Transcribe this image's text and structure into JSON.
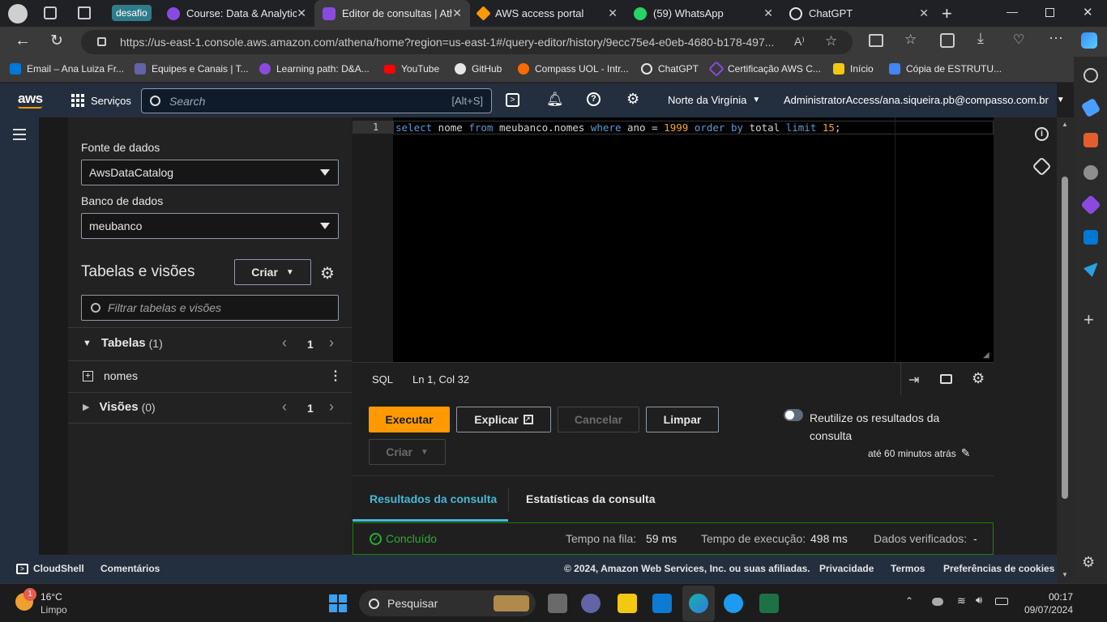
{
  "browser": {
    "tabs": [
      {
        "label": "Course: Data & Analytic",
        "color": "#8a4ae0"
      },
      {
        "label": "Editor de consultas | Ath",
        "color": "#8a4ae0"
      },
      {
        "label": "AWS access portal",
        "color": "#ff9900"
      },
      {
        "label": "(59) WhatsApp",
        "color": "#25d366"
      },
      {
        "label": "ChatGPT",
        "color": "#e6e6e6"
      }
    ],
    "group_label": "desafio",
    "group_color": "#2f7d8c",
    "url": "https://us-east-1.console.aws.amazon.com/athena/home?region=us-east-1#/query-editor/history/9ecc75e4-e0eb-4680-b178-497...",
    "bookmarks": [
      {
        "label": "Email – Ana Luiza Fr...",
        "color": "#0078d4"
      },
      {
        "label": "Equipes e Canais | T...",
        "color": "#6264a7"
      },
      {
        "label": "Learning path: D&A...",
        "color": "#8a4ae0"
      },
      {
        "label": "YouTube",
        "color": "#ff0000"
      },
      {
        "label": "GitHub",
        "color": "#e6e6e6"
      },
      {
        "label": "Compass UOL - Intr...",
        "color": "#ff6a00"
      },
      {
        "label": "ChatGPT",
        "color": "#e6e6e6"
      },
      {
        "label": "Certificação AWS C...",
        "color": "#8a4ae0"
      },
      {
        "label": "Início",
        "color": "#f2c811"
      },
      {
        "label": "Cópia de ESTRUTU...",
        "color": "#4285f4"
      }
    ]
  },
  "aws": {
    "services_label": "Serviços",
    "search_placeholder": "Search",
    "search_shortcut": "[Alt+S]",
    "region": "Norte da Virgínia",
    "account": "AdministratorAccess/ana.siqueira.pb@compasso.com.br"
  },
  "panel": {
    "datasource_label": "Fonte de dados",
    "datasource_value": "AwsDataCatalog",
    "database_label": "Banco de dados",
    "database_value": "meubanco",
    "tables_views_title": "Tabelas e visões",
    "create_label": "Criar",
    "filter_placeholder": "Filtrar tabelas e visões",
    "tables_label": "Tabelas",
    "tables_count": "(1)",
    "tables_page": "1",
    "table_item": "nomes",
    "views_label": "Visões",
    "views_count": "(0)",
    "views_page": "1"
  },
  "editor": {
    "line_number": "1",
    "code_tokens": [
      {
        "t": "select",
        "c": "#569cd6"
      },
      {
        "t": " nome ",
        "c": "#d4d4d4"
      },
      {
        "t": "from",
        "c": "#569cd6"
      },
      {
        "t": " meubanco.nomes ",
        "c": "#d4d4d4"
      },
      {
        "t": "where",
        "c": "#569cd6"
      },
      {
        "t": " ano ",
        "c": "#d4d4d4"
      },
      {
        "t": "=",
        "c": "#d4d4d4"
      },
      {
        "t": " 1999 ",
        "c": "#f5a623"
      },
      {
        "t": "order",
        "c": "#569cd6"
      },
      {
        "t": " ",
        "c": "#d4d4d4"
      },
      {
        "t": "by",
        "c": "#569cd6"
      },
      {
        "t": " total ",
        "c": "#d4d4d4"
      },
      {
        "t": "limit",
        "c": "#569cd6"
      },
      {
        "t": " 15",
        "c": "#f5a623"
      },
      {
        "t": ";",
        "c": "#d4d4d4"
      }
    ],
    "language": "SQL",
    "cursor_position": "Ln 1, Col 32"
  },
  "actions": {
    "run": "Executar",
    "explain": "Explicar",
    "cancel": "Cancelar",
    "clear": "Limpar",
    "create": "Criar",
    "reuse_label_1": "Reutilize os resultados da",
    "reuse_label_2": "consulta",
    "reuse_time": "até 60 minutos atrás"
  },
  "results": {
    "tab_results": "Resultados da consulta",
    "tab_stats": "Estatísticas da consulta",
    "status": "Concluído",
    "queue_label": "Tempo na fila:",
    "queue_value": "59 ms",
    "exec_label": "Tempo de execução:",
    "exec_value": "498 ms",
    "scanned_label": "Dados verificados:",
    "scanned_value": "-"
  },
  "footer": {
    "cloudshell": "CloudShell",
    "comments": "Comentários",
    "copyright": "© 2024, Amazon Web Services, Inc. ou suas afiliadas.",
    "privacy": "Privacidade",
    "terms": "Termos",
    "cookies": "Preferências de cookies"
  },
  "taskbar": {
    "weather_temp": "16°C",
    "weather_desc": "Limpo",
    "weather_badge": "1",
    "search_label": "Pesquisar",
    "time": "00:17",
    "date": "09/07/2024"
  }
}
